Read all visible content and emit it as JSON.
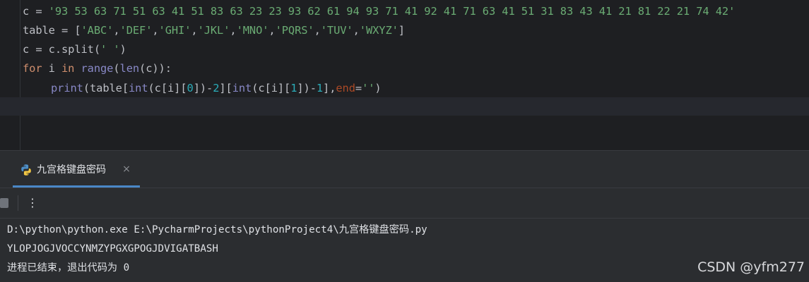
{
  "editor": {
    "lines": [
      {
        "var": "c",
        "op": " = ",
        "string": "'93 53 63 71 51 63 41 51 83 63 23 23 93 62 61 94 93 71 41 92 41 71 63 41 51 31 83 43 41 21 81 22 21 74 42'"
      },
      {
        "var": "table",
        "op": " = [",
        "items": [
          "'ABC'",
          "'DEF'",
          "'GHI'",
          "'JKL'",
          "'MNO'",
          "'PQRS'",
          "'TUV'",
          "'WXYZ'"
        ],
        "sep": ",",
        "close": "]"
      },
      {
        "text_a": "c = c.split(",
        "string": "' '",
        "text_b": ")"
      },
      {
        "kw_for": "for",
        "var": " i ",
        "kw_in": "in",
        "sp": " ",
        "fn_range": "range",
        "paren1": "(",
        "fn_len": "len",
        "paren2": "(c)):"
      },
      {
        "fn_print": "print",
        "p1": "(table[",
        "fn_int1": "int",
        "p2": "(c[i][",
        "n0": "0",
        "p3": "])-",
        "n2": "2",
        "p4": "][",
        "fn_int2": "int",
        "p5": "(c[i][",
        "n1": "1",
        "p6": "])-",
        "n1b": "1",
        "p7": "],",
        "kw_end": "end",
        "p8": "=",
        "empty": "''",
        "p9": ")"
      }
    ]
  },
  "run_tab": {
    "label": "九宫格键盘密码",
    "icon": "python-icon",
    "close": "×"
  },
  "toolbar": {
    "stop_icon": "stop-icon",
    "more_symbol": "⋮"
  },
  "console": {
    "lines": [
      "D:\\python\\python.exe E:\\PycharmProjects\\pythonProject4\\九宫格键盘密码.py",
      "YLOPJOGJVOCCYNMZYPGXGPOGJDVIGATBASH",
      "进程已结束，退出代码为 0"
    ]
  },
  "watermark": "CSDN @yfm277"
}
